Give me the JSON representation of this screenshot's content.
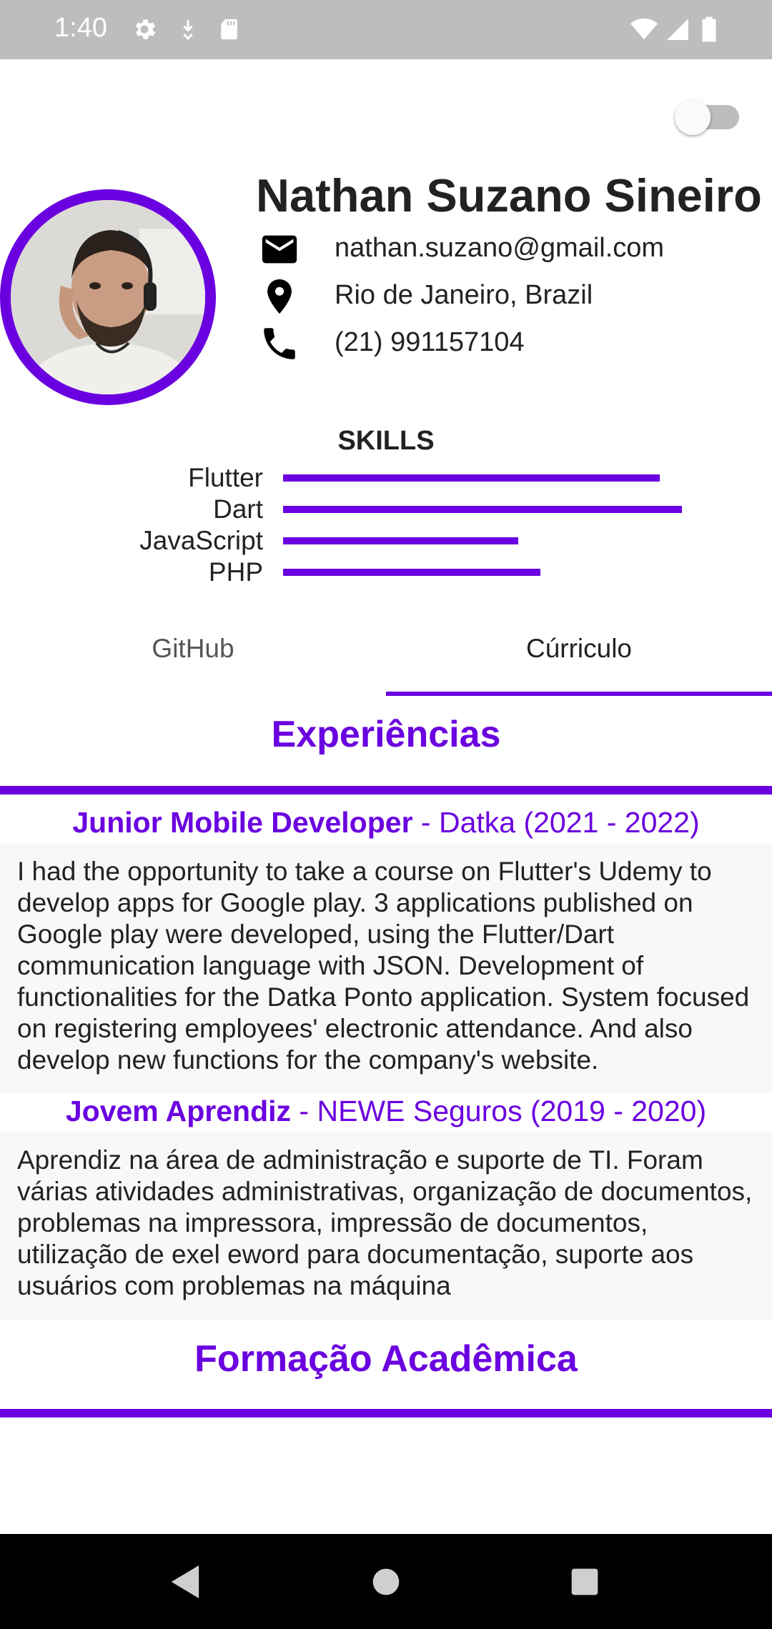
{
  "status_bar": {
    "time": "1:40"
  },
  "profile": {
    "name": "Nathan Suzano Sineiro",
    "email": "nathan.suzano@gmail.com",
    "location": "Rio de Janeiro, Brazil",
    "phone": "(21) 991157104"
  },
  "skills": {
    "title": "SKILLS",
    "items": [
      {
        "label": "Flutter",
        "level": 0.85
      },
      {
        "label": "Dart",
        "level": 0.9
      },
      {
        "label": "JavaScript",
        "level": 0.53
      },
      {
        "label": "PHP",
        "level": 0.58
      }
    ]
  },
  "tabs": [
    {
      "label": "GitHub",
      "selected": false
    },
    {
      "label": "Cúrriculo",
      "selected": true
    }
  ],
  "experience": {
    "title": "Experiências",
    "jobs": [
      {
        "role": "Junior Mobile Developer",
        "company": "  - Datka (2021 - 2022)",
        "description": "I had the opportunity to take a course on Flutter's Udemy to develop apps for Google play. 3 applications published on Google play were developed, using the Flutter/Dart communication language with JSON. Development of functionalities for the Datka Ponto application. System focused on registering employees' electronic attendance. And also develop new functions for the company's website."
      },
      {
        "role": "Jovem Aprendiz",
        "company": " - NEWE Seguros (2019 - 2020)",
        "description": "Aprendiz na área de administração e suporte de TI. Foram várias atividades administrativas, organização de documentos, problemas na impressora, impressão de documentos, utilização de exel eword para documentação, suporte aos usuários com problemas na máquina"
      }
    ]
  },
  "education": {
    "title": "Formação Acadêmica"
  },
  "colors": {
    "accent": "#6a00e0",
    "status_bar": "#bdbdbd",
    "nav_bar": "#000000"
  },
  "icons": [
    "settings-icon",
    "download-icon",
    "sd-card-icon",
    "wifi-icon",
    "signal-icon",
    "battery-icon",
    "mail-icon",
    "location-pin-icon",
    "phone-icon",
    "back-icon",
    "home-icon",
    "recents-icon"
  ]
}
